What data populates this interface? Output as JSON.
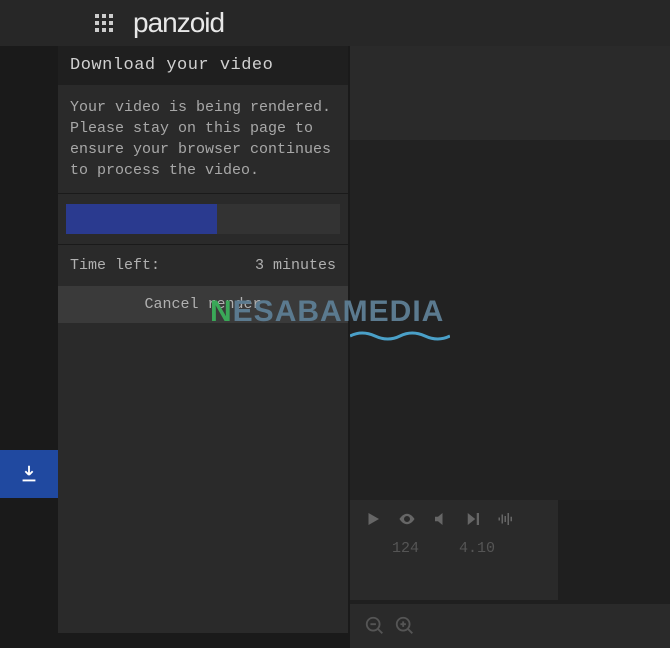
{
  "header": {
    "logo": "panzoid"
  },
  "panel": {
    "title": "Download your video",
    "message": "Your video is being rendered. Please stay on this page to ensure your browser continues to process the video.",
    "time_label": "Time left:",
    "time_value": "3 minutes",
    "cancel_label": "Cancel render",
    "progress_percent": 55
  },
  "controls": {
    "frame": "124",
    "time": "4.10"
  },
  "watermark": {
    "n": "N",
    "rest": "ESABAMEDIA"
  }
}
